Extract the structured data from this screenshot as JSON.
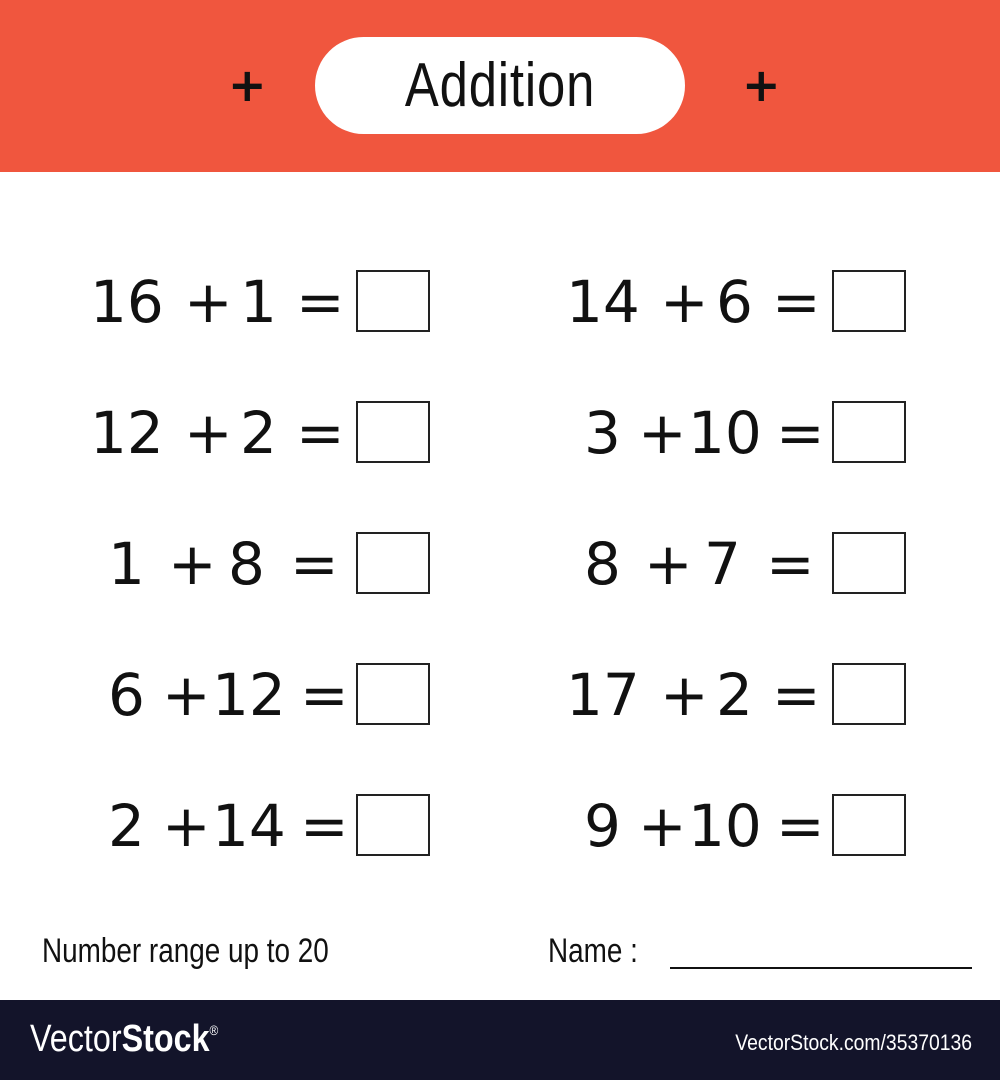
{
  "header": {
    "title": "Addition",
    "left_symbol": "+",
    "right_symbol": "+",
    "accent_color": "#f0563e"
  },
  "equations": {
    "left": [
      {
        "a": "16",
        "op": "+",
        "b": "1",
        "eq": "="
      },
      {
        "a": "12",
        "op": "+",
        "b": "2",
        "eq": "="
      },
      {
        "a": "1",
        "op": "+",
        "b": "8",
        "eq": "="
      },
      {
        "a": "6",
        "op": "+",
        "b": "12",
        "eq": "="
      },
      {
        "a": "2",
        "op": "+",
        "b": "14",
        "eq": "="
      }
    ],
    "right": [
      {
        "a": "14",
        "op": "+",
        "b": "6",
        "eq": "="
      },
      {
        "a": "3",
        "op": "+",
        "b": "10",
        "eq": "="
      },
      {
        "a": "8",
        "op": "+",
        "b": "7",
        "eq": "="
      },
      {
        "a": "17",
        "op": "+",
        "b": "2",
        "eq": "="
      },
      {
        "a": "9",
        "op": "+",
        "b": "10",
        "eq": "="
      }
    ]
  },
  "footer": {
    "range_label": "Number range up to 20",
    "name_label": "Name :"
  },
  "watermark": {
    "brand_light": "Vector",
    "brand_bold": "Stock",
    "registered": "®",
    "stock_id": "VectorStock.com/35370136"
  }
}
